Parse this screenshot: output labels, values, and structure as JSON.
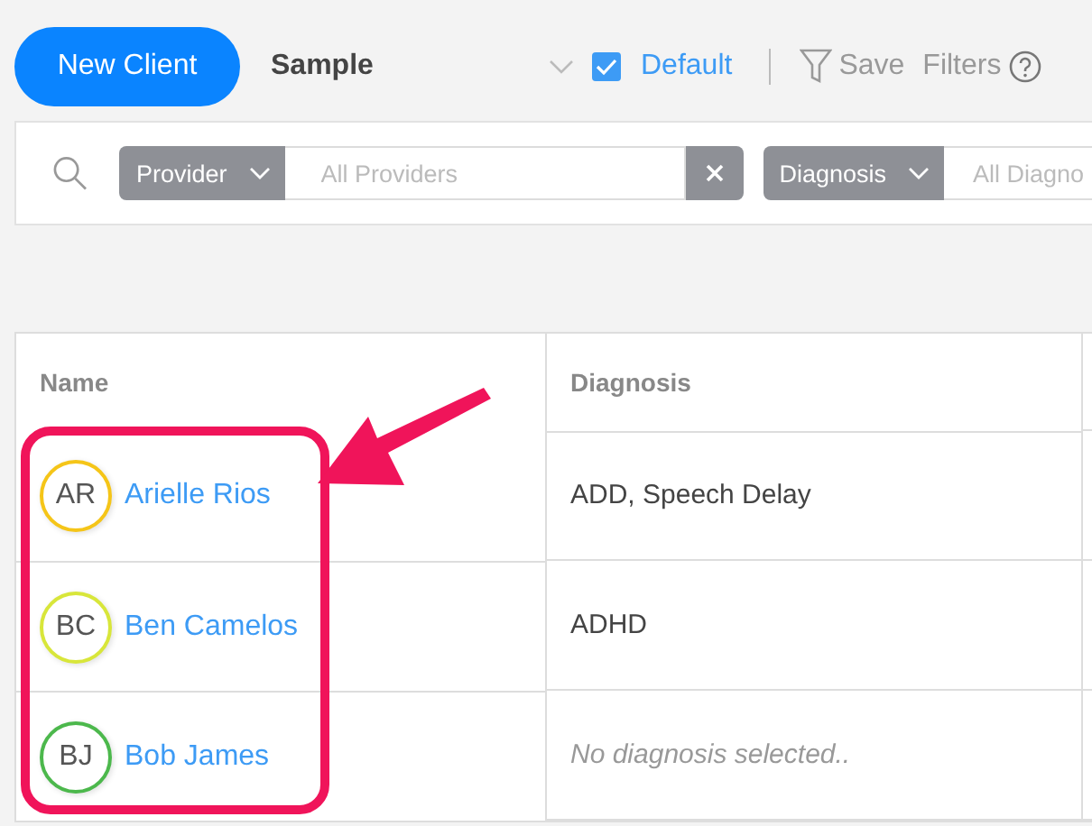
{
  "toolbar": {
    "new_button": "New Client",
    "view_name": "Sample",
    "default_checked": true,
    "default_label": "Default",
    "save_label": "Save",
    "filters_label": "Filters"
  },
  "filters": [
    {
      "label": "Provider",
      "placeholder": "All Providers",
      "clearable": true
    },
    {
      "label": "Diagnosis",
      "placeholder": "All Diagno",
      "clearable": false
    }
  ],
  "table": {
    "columns": [
      "Name",
      "Diagnosis"
    ],
    "rows": [
      {
        "initials": "AR",
        "name": "Arielle Rios",
        "color": "#f5c518",
        "diagnosis": "ADD, Speech Delay",
        "diagnosis_placeholder": false
      },
      {
        "initials": "BC",
        "name": "Ben Camelos",
        "color": "#d8e63a",
        "diagnosis": "ADHD",
        "diagnosis_placeholder": false
      },
      {
        "initials": "BJ",
        "name": "Bob James",
        "color": "#4cb84c",
        "diagnosis": "No diagnosis selected..",
        "diagnosis_placeholder": true
      }
    ]
  }
}
